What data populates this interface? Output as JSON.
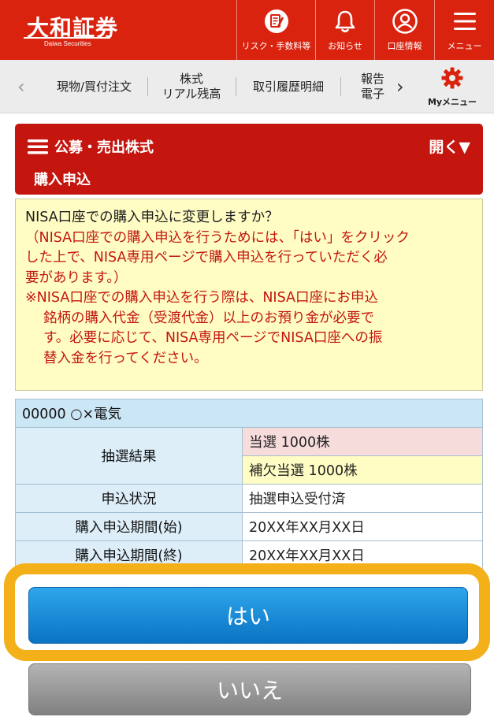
{
  "header": {
    "logo_text": "大和証券",
    "logo_sub": "Daiwa Securities",
    "buttons": [
      {
        "label": "リスク・手数料等",
        "icon": "document-pen-icon"
      },
      {
        "label": "お知らせ",
        "icon": "bell-icon"
      },
      {
        "label": "口座情報",
        "icon": "user-circle-icon"
      },
      {
        "label": "メニュー",
        "icon": "hamburger-menu-icon"
      }
    ]
  },
  "tabs": {
    "items": [
      {
        "line1": "現物/買付注文",
        "line2": ""
      },
      {
        "line1": "株式",
        "line2": "リアル残高"
      },
      {
        "line1": "取引履歴明細",
        "line2": ""
      },
      {
        "line1": "報告",
        "line2": "電子"
      }
    ],
    "my_menu_label": "Myメニュー"
  },
  "section": {
    "title": "公募・売出株式",
    "toggle_label": "開く▼",
    "subtitle": "購入申込"
  },
  "notice": {
    "question": "NISA口座での購入申込に変更しますか？",
    "paren_lines": [
      "（NISA口座での購入申込を行うためには、「はい」をクリック",
      "した上で、NISA専用ページで購入申込を行っていただく必",
      "要があります。）"
    ],
    "note_first": "※NISA口座での購入申込を行う際は、NISA口座にお申込",
    "note_rest": [
      "銘柄の購入代金（受渡代金）以上のお預り金が必要で",
      "す。必要に応じて、NISA専用ページでNISA口座への振",
      "替入金を行ってください。"
    ]
  },
  "stock": {
    "title": "00000 ○×電気",
    "lottery_label": "抽選結果",
    "lottery_win": "当選 1000株",
    "lottery_sub": "補欠当選 1000株",
    "status_label": "申込状況",
    "status_value": "抽選申込受付済",
    "start_label": "購入申込期間(始)",
    "start_value": "20XX年XX月XX日",
    "end_label": "購入申込期間(終)",
    "end_value": "20XX年XX月XX日"
  },
  "actions": {
    "yes_label": "はい",
    "no_label": "いいえ"
  },
  "colors": {
    "brand_red": "#d9230f",
    "section_red": "#c4150f",
    "notice_yellow": "#fffdc4",
    "highlight_orange": "#f3b019",
    "yes_blue": "#1a8ad6"
  }
}
